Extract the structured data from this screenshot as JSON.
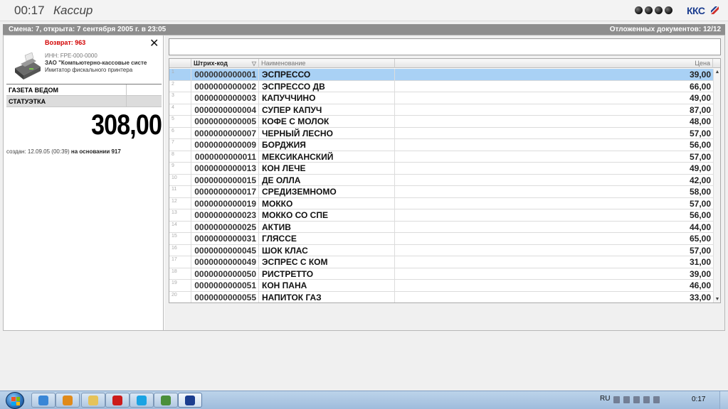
{
  "topbar": {
    "clock": "00:17",
    "role": "Кассир",
    "logo": "ККС"
  },
  "shift": {
    "info": "Смена: 7, открыта: 7 сентября 2005 г. в 23:05",
    "deferred": "Отложенных документов: 12/12"
  },
  "return_panel": {
    "title": "Возврат: 963",
    "close_glyph": "✕",
    "inn": "ИНН: FPE-000-0000",
    "company": "ЗАО \"Компьютерно-кассовые систе",
    "printer": "Имитатор фискального принтера",
    "items": [
      "ГАЗЕТА ВЕДОМ",
      "СТАТУЭТКА"
    ],
    "total": "308,00",
    "created_prefix": "создан: 12.09.05 (00:39)",
    "created_basis": "на основании 917"
  },
  "grid": {
    "columns": {
      "barcode": "Штрих-код",
      "name": "Наименование",
      "price": "Цена",
      "sort_glyph": "▽"
    },
    "rows": [
      {
        "num": "1",
        "barcode": "0000000000001",
        "name": "ЭСПРЕССО",
        "price": "39,00"
      },
      {
        "num": "2",
        "barcode": "0000000000002",
        "name": "ЭСПРЕССО ДВ",
        "price": "66,00"
      },
      {
        "num": "3",
        "barcode": "0000000000003",
        "name": "КАПУЧЧИНО",
        "price": "49,00"
      },
      {
        "num": "4",
        "barcode": "0000000000004",
        "name": "СУПЕР КАПУЧ",
        "price": "87,00"
      },
      {
        "num": "5",
        "barcode": "0000000000005",
        "name": "КОФЕ С МОЛОК",
        "price": "48,00"
      },
      {
        "num": "6",
        "barcode": "0000000000007",
        "name": "ЧЕРНЫЙ ЛЕСНО",
        "price": "57,00"
      },
      {
        "num": "7",
        "barcode": "0000000000009",
        "name": "БОРДЖИЯ",
        "price": "56,00"
      },
      {
        "num": "8",
        "barcode": "0000000000011",
        "name": "МЕКСИКАНСКИЙ",
        "price": "57,00"
      },
      {
        "num": "9",
        "barcode": "0000000000013",
        "name": "КОН ЛЕЧЕ",
        "price": "49,00"
      },
      {
        "num": "10",
        "barcode": "0000000000015",
        "name": "ДЕ ОЛЛА",
        "price": "42,00"
      },
      {
        "num": "11",
        "barcode": "0000000000017",
        "name": "СРЕДИЗЕМНОМО",
        "price": "58,00"
      },
      {
        "num": "12",
        "barcode": "0000000000019",
        "name": "МОККО",
        "price": "57,00"
      },
      {
        "num": "13",
        "barcode": "0000000000023",
        "name": "МОККО СО СПЕ",
        "price": "56,00"
      },
      {
        "num": "14",
        "barcode": "0000000000025",
        "name": "АКТИВ",
        "price": "44,00"
      },
      {
        "num": "15",
        "barcode": "0000000000031",
        "name": "ГЛЯССЕ",
        "price": "65,00"
      },
      {
        "num": "16",
        "barcode": "0000000000045",
        "name": "ШОК КЛАС",
        "price": "57,00"
      },
      {
        "num": "17",
        "barcode": "0000000000049",
        "name": "ЭСПРЕС С КОМ",
        "price": "31,00"
      },
      {
        "num": "18",
        "barcode": "0000000000050",
        "name": "РИСТРЕТТО",
        "price": "39,00"
      },
      {
        "num": "19",
        "barcode": "0000000000051",
        "name": "КОН ПАНА",
        "price": "46,00"
      },
      {
        "num": "20",
        "barcode": "0000000000055",
        "name": "НАПИТОК ГАЗ",
        "price": "33,00"
      }
    ]
  },
  "taskbar": {
    "apps": [
      {
        "icon": "internet-explorer-icon",
        "color": "#3a86d6"
      },
      {
        "icon": "media-player-icon",
        "color": "#e08a1a"
      },
      {
        "icon": "folder-icon",
        "color": "#e6c35a"
      },
      {
        "icon": "opera-icon",
        "color": "#cc1b1b"
      },
      {
        "icon": "skype-icon",
        "color": "#1aa3e3"
      },
      {
        "icon": "network-app-icon",
        "color": "#4a8f3a"
      },
      {
        "icon": "kks-app-icon",
        "color": "#1b3d8f"
      }
    ],
    "language": "RU",
    "clock": "0:17"
  }
}
